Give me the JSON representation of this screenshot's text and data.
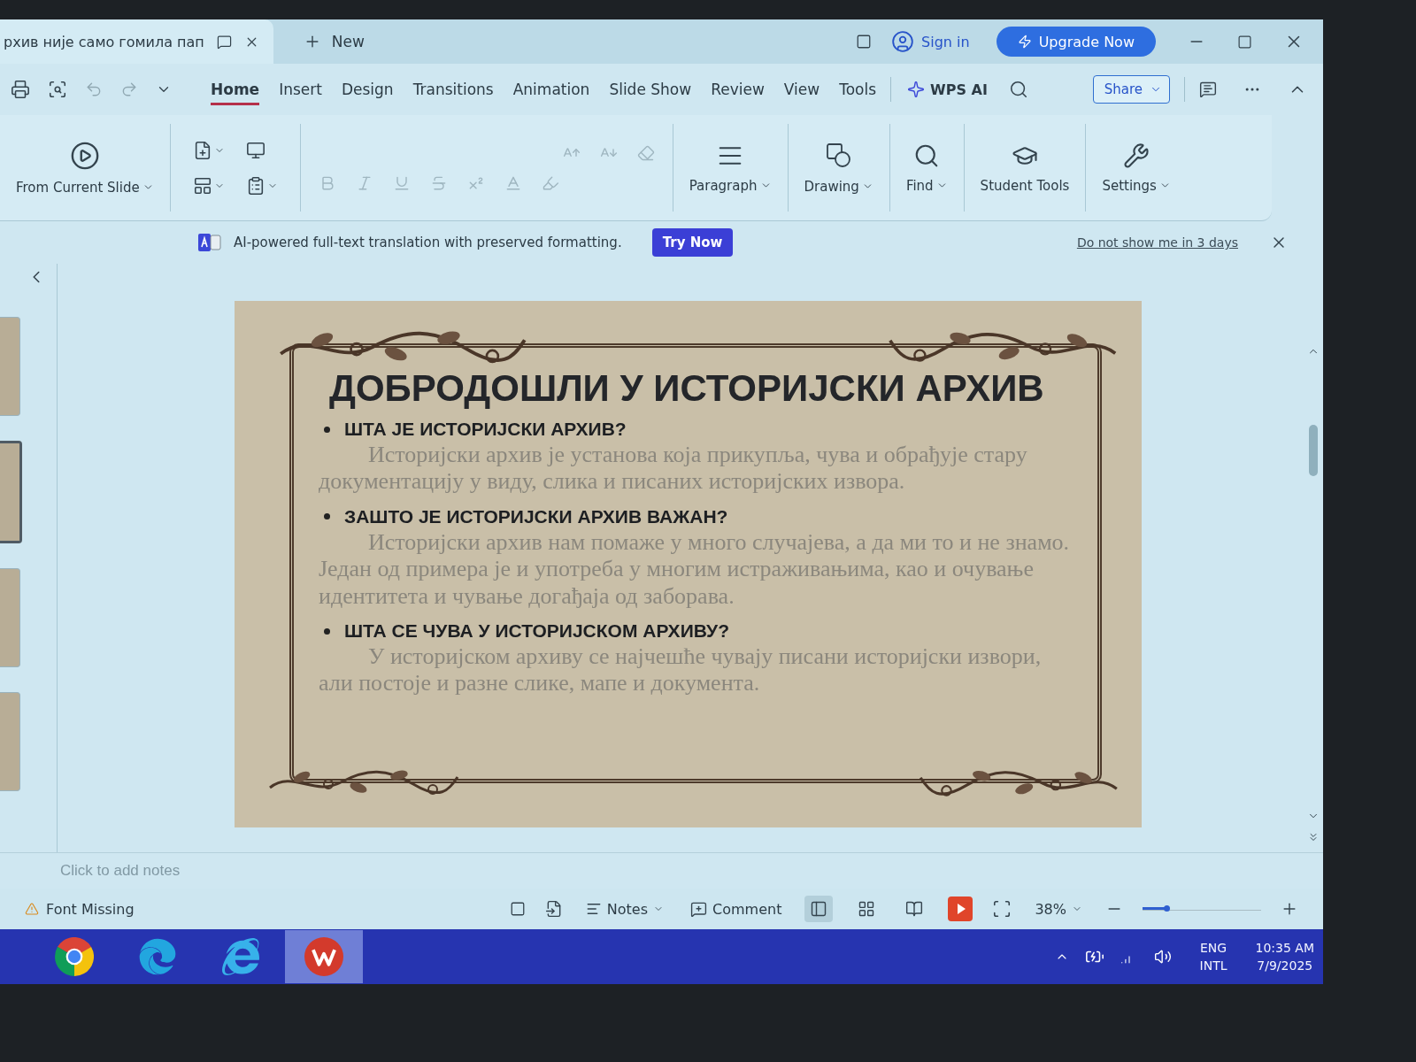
{
  "document_tab": {
    "title": "рхив није само гомила пап",
    "new_tab": "New"
  },
  "account": {
    "sign_in": "Sign in",
    "upgrade": "Upgrade Now",
    "share": "Share"
  },
  "menu_tabs": [
    {
      "label": "Home",
      "selected": true
    },
    {
      "label": "Insert",
      "selected": false
    },
    {
      "label": "Design",
      "selected": false
    },
    {
      "label": "Transitions",
      "selected": false
    },
    {
      "label": "Animation",
      "selected": false
    },
    {
      "label": "Slide Show",
      "selected": false
    },
    {
      "label": "Review",
      "selected": false
    },
    {
      "label": "View",
      "selected": false
    },
    {
      "label": "Tools",
      "selected": false
    }
  ],
  "ai_button": "WPS AI",
  "ribbon": {
    "start_button": "From Current Slide",
    "font_group": {
      "disabled": true
    },
    "tools": [
      {
        "label": "Paragraph",
        "dropdown": true
      },
      {
        "label": "Drawing",
        "dropdown": true
      },
      {
        "label": "Find",
        "dropdown": true
      },
      {
        "label": "Student Tools",
        "dropdown": false
      },
      {
        "label": "Settings",
        "dropdown": true
      }
    ]
  },
  "banner": {
    "text": "AI-powered full-text translation with preserved formatting.",
    "button": "Try Now",
    "dismiss": "Do not show me in 3 days"
  },
  "thumbnails": [
    {
      "selected": false
    },
    {
      "selected": true
    },
    {
      "selected": false
    },
    {
      "selected": false
    }
  ],
  "slide": {
    "title": "ДОБРОДОШЛИ У ИСТОРИЈСКИ АРХИВ",
    "sections": [
      {
        "heading": "ШТА ЈЕ ИСТОРИЈСКИ АРХИВ?",
        "body": "Историјски архив је установа која прикупља, чува и обрађује стару документацију у виду, слика и писаних историјских извора."
      },
      {
        "heading": "ЗАШТО ЈЕ ИСТОРИЈСКИ АРХИВ ВАЖАН?",
        "body": "Историјски архив нам помаже у много случајева, а да ми то и не знамо. Један од примера је и употреба у многим истраживањима, као и очување идентитета и чување догађаја од заборава."
      },
      {
        "heading": "ШТА СЕ ЧУВА У ИСТОРИЈСКОМ АРХИВУ?",
        "body": "У историјском архиву се најчешће чувају писани историјски извори, али постоје и разне слике, мапе и документа."
      }
    ]
  },
  "notes": {
    "placeholder": "Click to add notes"
  },
  "status_bar": {
    "warning": "Font Missing",
    "notes": "Notes",
    "comment": "Comment",
    "views": [
      {
        "selected": true
      },
      {
        "selected": false
      },
      {
        "selected": false
      }
    ],
    "zoom": "38%",
    "zoom_slider": {
      "level": 0.2
    }
  },
  "taskbar": {
    "apps": [
      {
        "selected": false
      },
      {
        "selected": false
      },
      {
        "selected": false
      },
      {
        "selected": true
      }
    ],
    "language": "ENG",
    "layout": "INTL",
    "time": "10:35 AM",
    "date": "7/9/2025"
  }
}
